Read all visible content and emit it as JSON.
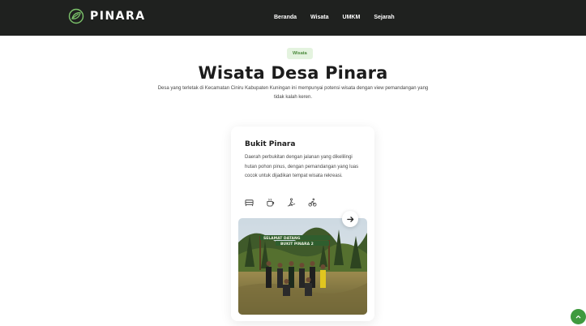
{
  "nav": {
    "brand": "PINARA",
    "links": [
      "Beranda",
      "Wisata",
      "UMKM",
      "Sejarah"
    ]
  },
  "hero": {
    "badge": "Wisata",
    "title": "Wisata Desa Pinara",
    "description": "Desa yang terletak di Kecamatan Ciniru Kabupaten Kuningan ini mempunyai potensi wisata dengan view pemandangan yang tidak kalah keren."
  },
  "card": {
    "title": "Bukit Pinara",
    "description": "Daerah perbukitan dengan jalanan yang dikelilingi hutan pohon pinus, dengan pemandangan yang luas cocok untuk dijadikan tempat wisata rekreasi.",
    "facility_icons": [
      "bed-icon",
      "coffee-icon",
      "hiking-icon",
      "bike-icon"
    ],
    "photo_sign": [
      "SELAMAT DATANG",
      "BUKIT PINARA 2"
    ],
    "arrow_icon": "arrow-right-icon"
  },
  "colors": {
    "navbar": "#1f211f",
    "accent": "#3f9a3f",
    "badge_bg": "#e4f3df",
    "badge_text": "#4b8a3c"
  },
  "scroll_top_icon": "chevron-up-icon"
}
